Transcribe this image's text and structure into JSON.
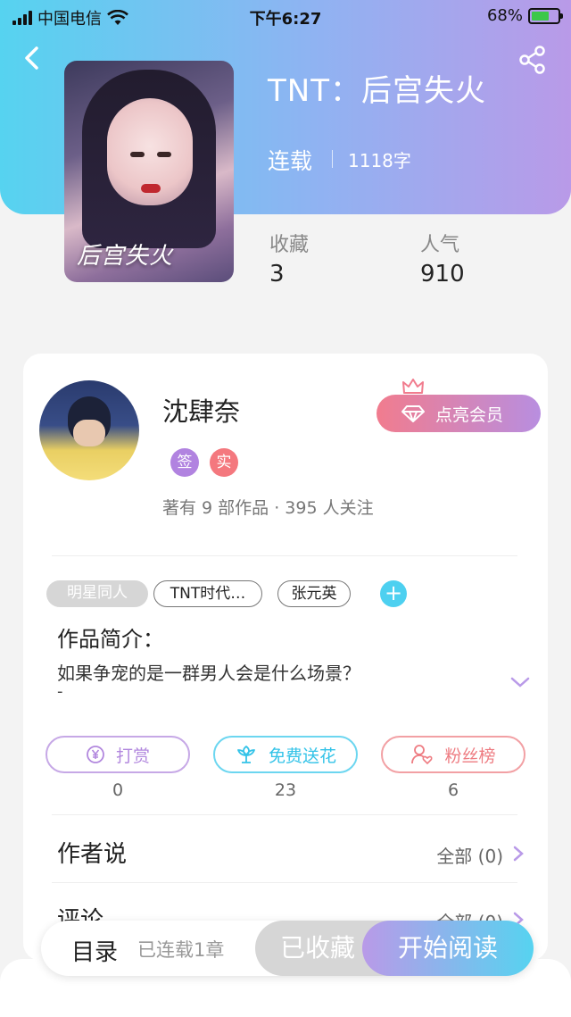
{
  "status_bar": {
    "carrier": "中国电信",
    "time": "下午6:27",
    "battery": "68%",
    "battery_level": 0.68
  },
  "book": {
    "title": "TNT：后宫失火",
    "cover_title": "后宫失火",
    "status": "连载",
    "word_count": "1118字",
    "stats": {
      "favorites_label": "收藏",
      "favorites_value": "3",
      "popularity_label": "人气",
      "popularity_value": "910"
    }
  },
  "author": {
    "name": "沈肆奈",
    "badges": [
      "签",
      "实"
    ],
    "meta": "著有 9 部作品 · 395 人关注",
    "vip_button": "点亮会员"
  },
  "tags": {
    "category": "明星同人",
    "items": [
      "TNT时代…",
      "张元英"
    ],
    "add": "+"
  },
  "intro": {
    "label": "作品简介：",
    "text": "如果争宠的是一群男人会是什么场景？",
    "dash": "-"
  },
  "actions": [
    {
      "label": "打赏",
      "count": "0",
      "icon": "yen-coin-icon"
    },
    {
      "label": "免费送花",
      "count": "23",
      "icon": "flower-icon"
    },
    {
      "label": "粉丝榜",
      "count": "6",
      "icon": "user-heart-icon"
    }
  ],
  "sections": [
    {
      "label": "作者说",
      "more": "全部 (0)"
    },
    {
      "label": "评论",
      "more": "全部 (0)"
    }
  ],
  "bottom_bar": {
    "catalog": "目录",
    "serial_count": "已连载1章",
    "collected": "已收藏",
    "start_reading": "开始阅读"
  },
  "colors": {
    "accent_blue": "#56d3f0",
    "accent_purple": "#b99ae8",
    "accent_pink": "#f17c8e"
  }
}
